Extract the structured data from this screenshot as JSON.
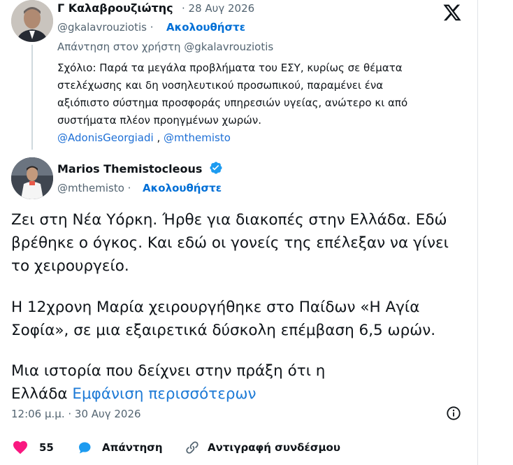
{
  "reply_tweet": {
    "author_name": "Γ Καλαβρουζιώτης",
    "date": "· 28 Αυγ 2026",
    "handle": "@gkalavrouziotis ·",
    "follow_label": "Ακολουθήστε",
    "replying_to": "Απάντηση στον χρήστη @gkalavrouziotis",
    "text_lines": [
      "Σχόλιο: Παρά τα μεγάλα προβλήματα του ΕΣΥ, κυρίως σε θέματα",
      "στελέχωσης και δη νοσηλευτικού προσωπικού, παραμένει ένα",
      "αξιόπιστο σύστημα προσφοράς υπηρεσιών υγείας, ανώτερο κι από",
      "συστήματα πλέον προηγμένων χωρών."
    ],
    "mention_1": "@AdonisGeorgiadi",
    "mention_sep": " , ",
    "mention_2": "@mthemisto"
  },
  "main_tweet": {
    "author_name": "Marios Themistocleous",
    "handle": "@mthemisto ·",
    "follow_label": "Ακολουθήστε",
    "para1_lines": [
      "Ζει στη Νέα Υόρκη. Ήρθε για διακοπές στην Ελλάδα. Εδώ",
      "βρέθηκε ο όγκος. Και εδώ οι γονείς της επέλεξαν να γίνει",
      "το χειρουργείο."
    ],
    "para2_lines": [
      "Η 12χρονη Μαρία χειρουργήθηκε στο Παίδων «Η Αγία",
      "Σοφία», σε μια εξαιρετικά δύσκολη επέμβαση 6,5 ωρών."
    ],
    "para3_line1": "Μια ιστορία που δείχνει στην πράξη ότι η",
    "para3_line2": "Ελλάδα ",
    "show_more": "Εμφάνιση περισσότερων",
    "timestamp": "12:06 μ.μ. · 30 Αυγ 2026",
    "like_count": "55",
    "reply_label": "Απάντηση",
    "copy_link_label": "Αντιγραφή συνδέσμου"
  },
  "colors": {
    "link": "#1d6fd6",
    "follow": "#006fd6",
    "like": "#f91880",
    "verified": "#1d9bf0",
    "reply_icon": "#1d9bf0"
  },
  "icons": [
    "x-logo-icon",
    "verified-badge-icon",
    "info-icon",
    "heart-icon",
    "reply-bubble-icon",
    "link-icon"
  ]
}
